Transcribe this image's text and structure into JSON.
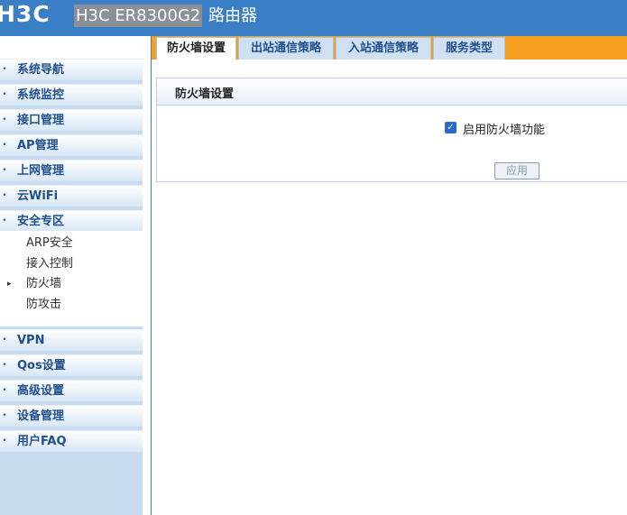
{
  "header": {
    "logo": "H3C",
    "model": "H3C ER8300G2",
    "title_suffix": "路由器"
  },
  "sidebar": {
    "items": [
      {
        "label": "系统导航"
      },
      {
        "label": "系统监控"
      },
      {
        "label": "接口管理"
      },
      {
        "label": "AP管理"
      },
      {
        "label": "上网管理"
      },
      {
        "label": "云WiFi"
      },
      {
        "label": "安全专区"
      },
      {
        "label": "VPN"
      },
      {
        "label": "Qos设置"
      },
      {
        "label": "高级设置"
      },
      {
        "label": "设备管理"
      },
      {
        "label": "用户FAQ"
      }
    ],
    "sub_items": [
      {
        "label": "ARP安全"
      },
      {
        "label": "接入控制"
      },
      {
        "label": "防火墙"
      },
      {
        "label": "防攻击"
      }
    ]
  },
  "tabs": [
    {
      "label": "防火墙设置"
    },
    {
      "label": "出站通信策略"
    },
    {
      "label": "入站通信策略"
    },
    {
      "label": "服务类型"
    }
  ],
  "panel": {
    "title": "防火墙设置",
    "checkbox_label": "启用防火墙功能",
    "checkbox_checked": true,
    "apply_label": "应用"
  }
}
